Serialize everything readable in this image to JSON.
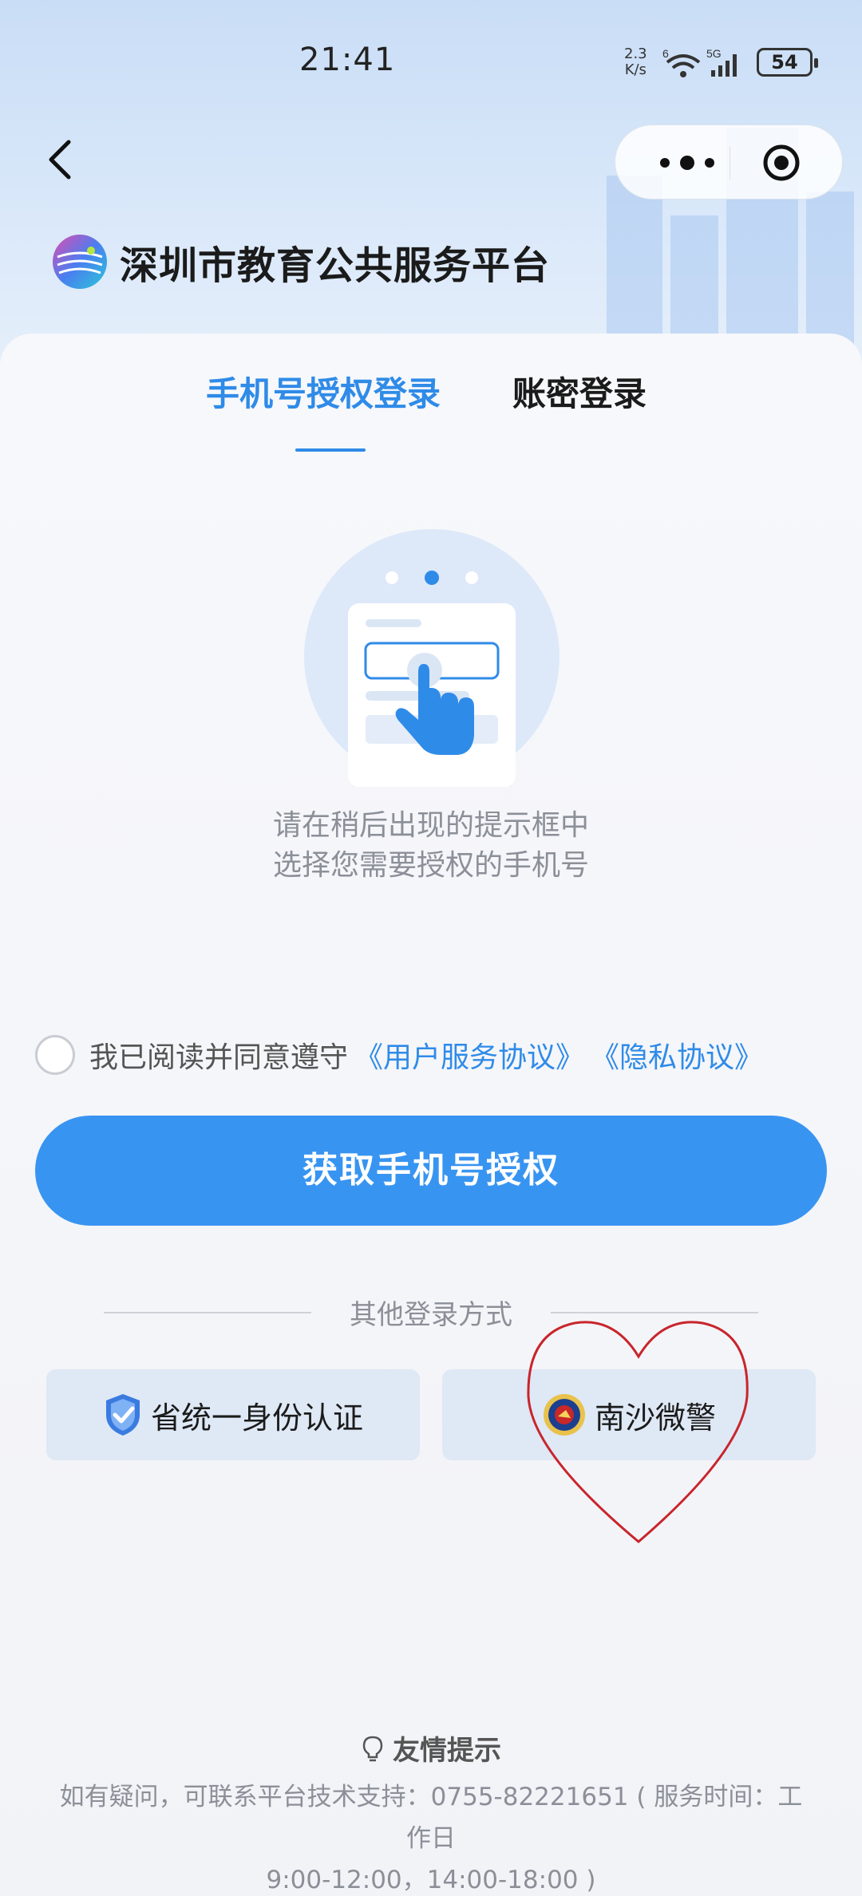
{
  "status_bar": {
    "time": "21:41",
    "net_speed_value": "2.3",
    "net_speed_unit": "K/s",
    "wifi_badge": "6",
    "signal_badge": "5G",
    "battery": "54",
    "icons": [
      "wifi-icon",
      "signal-icon",
      "battery-icon"
    ]
  },
  "nav": {
    "back_icon": "chevron-left-icon",
    "menu_icon": "more-dots-icon",
    "close_icon": "target-close-icon"
  },
  "brand": {
    "title": "深圳市教育公共服务平台"
  },
  "tabs": {
    "phone_label": "手机号授权登录",
    "account_label": "账密登录",
    "active": "phone"
  },
  "illustration": {
    "hint_line1": "请在稍后出现的提示框中",
    "hint_line2": "选择您需要授权的手机号"
  },
  "agreement": {
    "text": "我已阅读并同意遵守",
    "user_agreement": "《用户服务协议》",
    "privacy_agreement": "《隐私协议》",
    "checked": false
  },
  "primary_button": {
    "label": "获取手机号授权"
  },
  "other_login": {
    "label": "其他登录方式",
    "options": [
      {
        "label": "省统一身份认证",
        "icon": "shield-check-icon"
      },
      {
        "label": "南沙微警",
        "icon": "police-badge-icon"
      }
    ]
  },
  "tips": {
    "title": "友情提示",
    "line1": "如有疑问，可联系平台技术支持：0755-82221651 ( 服务时间：工作日",
    "line2": "9:00-12:00，14:00-18:00 )"
  },
  "colors": {
    "accent": "#3894f1",
    "tab_active": "#2f8be8",
    "annotation_heart": "#c8252c"
  }
}
